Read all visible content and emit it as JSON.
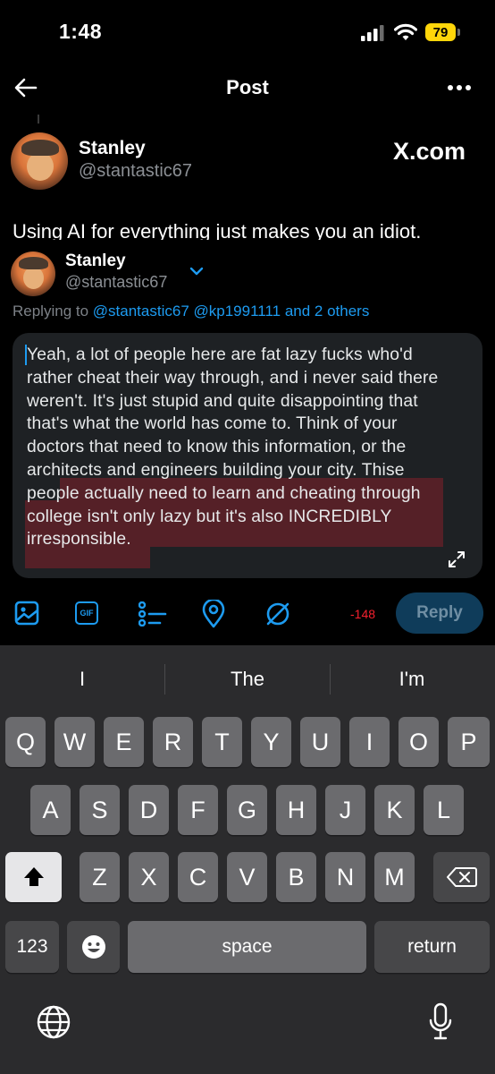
{
  "status": {
    "time": "1:48",
    "battery": "79"
  },
  "nav": {
    "title": "Post"
  },
  "post": {
    "author_name": "Stanley",
    "author_handle": "@stantastic67",
    "source_label": "X.com",
    "text": "Using AI for everything just makes you an idiot."
  },
  "compose": {
    "author_name": "Stanley",
    "author_handle": "@stantastic67",
    "replying_prefix": "Replying to",
    "replying_to": "@stantastic67 @kp1991111 and 2 others",
    "text_before_highlight": "Yeah, a lot of people here are fat lazy fucks who'd rather cheat their way through, and i never said there weren't. It's just stupid and quite disappointing that that's what the world has come to. Think of your doctors that need to know this information, or the architects and eng",
    "text_highlighted": "ineers building your city. Thise people actually need to learn and cheating through college isn't only lazy but it's also INCREDIBLY irresponsible.",
    "char_counter": "-148",
    "reply_label": "Reply"
  },
  "toolbar": {
    "icons": [
      "image-icon",
      "gif-icon",
      "poll-icon",
      "location-icon",
      "circle-icon"
    ],
    "gif_label": "GIF"
  },
  "keyboard": {
    "suggestions": [
      "I",
      "The",
      "I'm"
    ],
    "row1": [
      "Q",
      "W",
      "E",
      "R",
      "T",
      "Y",
      "U",
      "I",
      "O",
      "P"
    ],
    "row2": [
      "A",
      "S",
      "D",
      "F",
      "G",
      "H",
      "J",
      "K",
      "L"
    ],
    "row3": [
      "Z",
      "X",
      "C",
      "V",
      "B",
      "N",
      "M"
    ],
    "numbers_label": "123",
    "space_label": "space",
    "return_label": "return"
  },
  "colors": {
    "accent": "#1d9bf0",
    "highlight": "#552027",
    "battery": "#ffd60a",
    "counter": "#f4212e"
  }
}
